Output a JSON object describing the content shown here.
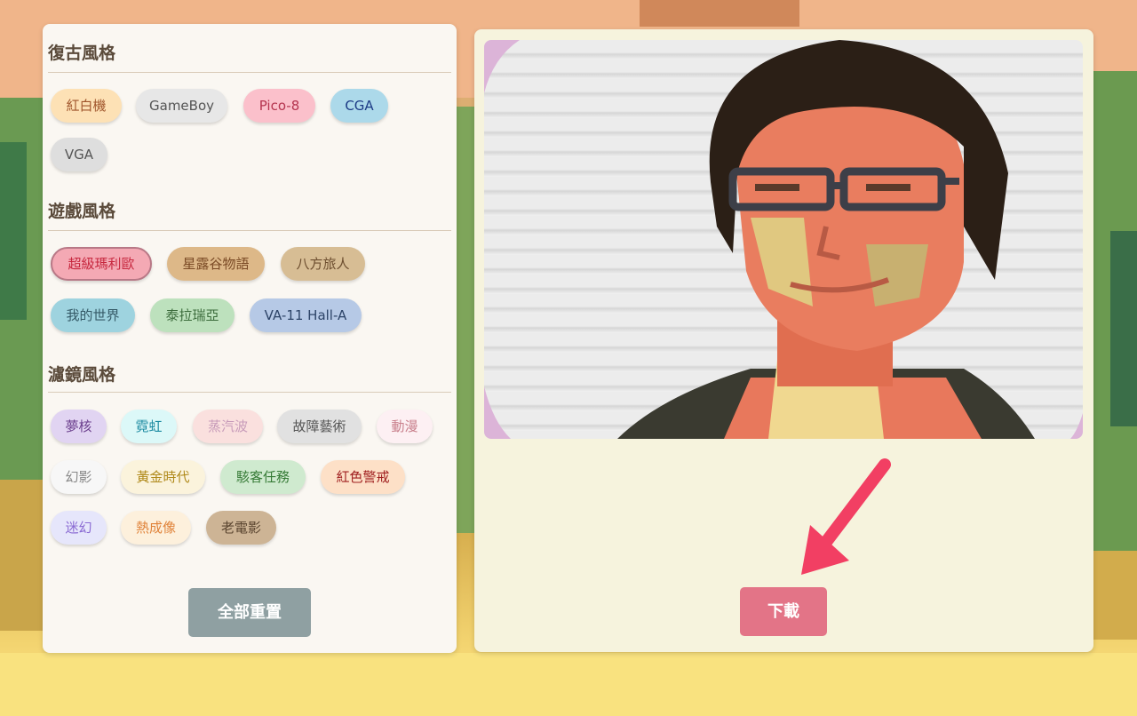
{
  "sections": {
    "retro": {
      "title": "復古風格"
    },
    "game": {
      "title": "遊戲風格"
    },
    "filter": {
      "title": "濾鏡風格"
    }
  },
  "chips": {
    "famicom": "紅白機",
    "gameboy": "GameBoy",
    "pico8": "Pico-8",
    "cga": "CGA",
    "vga": "VGA",
    "mario": "超級瑪利歐",
    "stardew": "星露谷物語",
    "octopath": "八方旅人",
    "minecraft": "我的世界",
    "terraria": "泰拉瑞亞",
    "va11": "VA-11 Hall-A",
    "dreamcore": "夢核",
    "neon": "霓虹",
    "vaporwave": "蒸汽波",
    "glitch": "故障藝術",
    "anime": "動漫",
    "phantom": "幻影",
    "golden": "黃金時代",
    "cyberpunk": "駭客任務",
    "redalert": "紅色警戒",
    "psychedelic": "迷幻",
    "thermal": "熱成像",
    "oldfilm": "老電影"
  },
  "actions": {
    "reset": "全部重置",
    "download": "下載"
  },
  "selected": "超級瑪利歐"
}
